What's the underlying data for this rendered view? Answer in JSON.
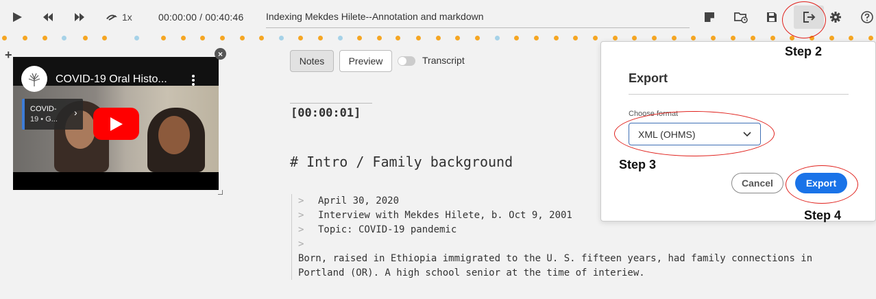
{
  "toolbar": {
    "speed": "1x",
    "timecode": "00:00:00 / 00:40:46",
    "title": "Indexing Mekdes Hilete--Annotation and markdown"
  },
  "video": {
    "title": "COVID-19 Oral Histo...",
    "card_line1": "COVID-",
    "card_line2": "19 • G..."
  },
  "editor": {
    "tabs": [
      {
        "label": "Notes",
        "active": true
      },
      {
        "label": "Preview",
        "active": false
      }
    ],
    "transcript_label": "Transcript",
    "timestamp": "[00:00:01]",
    "heading": "# Intro / Family background",
    "quote_marker": ">",
    "quote_lines": [
      "April 30, 2020",
      "Interview with Mekdes Hilete, b. Oct 9, 2001",
      "Topic: COVID-19 pandemic",
      ""
    ],
    "paragraph_lines": [
      " Born, raised in Ethiopia immigrated to the U. S. fifteen years, had family connections in",
      "Portland (OR). A high school senior at the time of interiew."
    ]
  },
  "export_dialog": {
    "title": "Export",
    "format_label": "Choose format",
    "format_value": "XML (OHMS)",
    "cancel_label": "Cancel",
    "export_label": "Export"
  },
  "annotations": {
    "step2": "Step 2",
    "step3": "Step 3",
    "step4": "Step 4"
  },
  "colors": {
    "accent": "#1a73e8",
    "annotation_red": "#e0201b",
    "timeline_orange": "#f5a623",
    "timeline_blue": "#a6d2e8"
  },
  "icons": [
    "play-icon",
    "rewind-icon",
    "fast-forward-icon",
    "speed-icon",
    "save-as-icon",
    "open-folder-icon",
    "save-icon",
    "export-icon",
    "settings-icon",
    "help-icon",
    "close-icon",
    "plus-icon",
    "chevron-down-icon"
  ]
}
